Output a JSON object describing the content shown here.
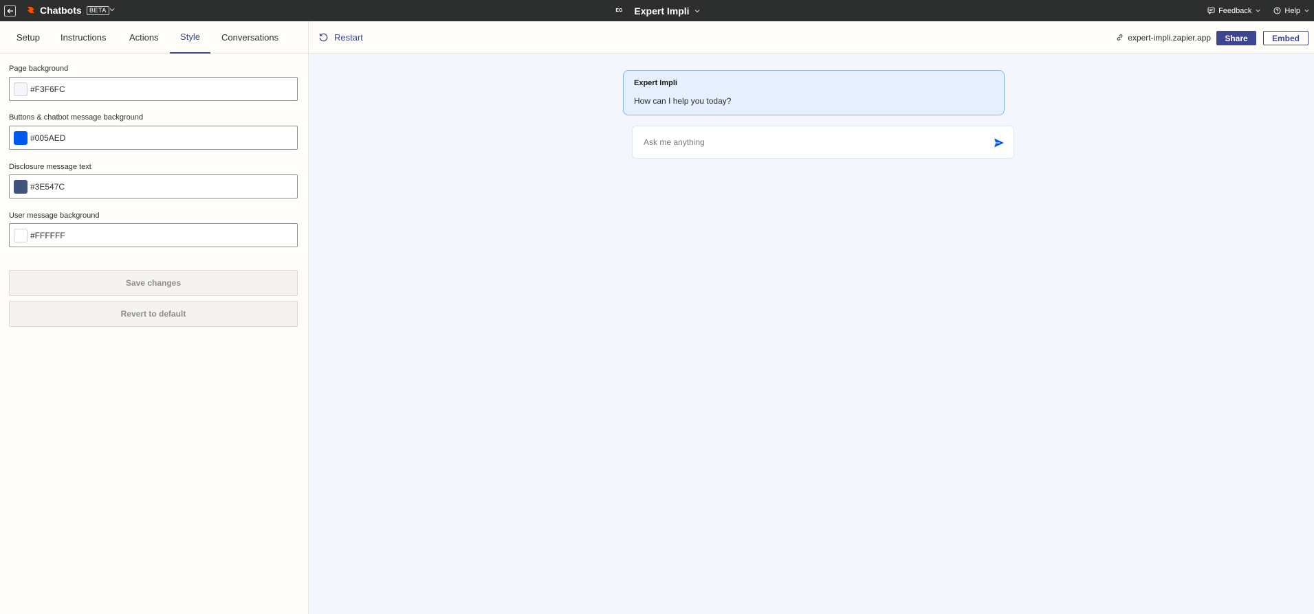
{
  "app": {
    "brand": "Chatbots",
    "beta": "BETA",
    "bot_initials": "EG",
    "bot_title": "Expert Impli",
    "feedback": "Feedback",
    "help": "Help"
  },
  "tabs": [
    {
      "label": "Setup"
    },
    {
      "label": "Instructions"
    },
    {
      "label": "Actions"
    },
    {
      "label": "Style",
      "active": true
    },
    {
      "label": "Conversations"
    }
  ],
  "style_fields": [
    {
      "label": "Page background",
      "value": "#F3F6FC",
      "color": "#F3F6FC"
    },
    {
      "label": "Buttons & chatbot message background",
      "value": "#005AED",
      "color": "#005AED"
    },
    {
      "label": "Disclosure message text",
      "value": "#3E547C",
      "color": "#3E547C"
    },
    {
      "label": "User message background",
      "value": "#FFFFFF",
      "color": "#FFFFFF"
    }
  ],
  "buttons": {
    "save": "Save changes",
    "revert": "Revert to default"
  },
  "preview": {
    "restart": "Restart",
    "link": "expert-impli.zapier.app",
    "share": "Share",
    "embed": "Embed",
    "bot_name": "Expert Impli",
    "bot_message": "How can I help you today?",
    "input_placeholder": "Ask me anything"
  },
  "colors": {
    "accent": "#3d4592",
    "brand_orange": "#FF4F00",
    "send": "#005AED"
  }
}
